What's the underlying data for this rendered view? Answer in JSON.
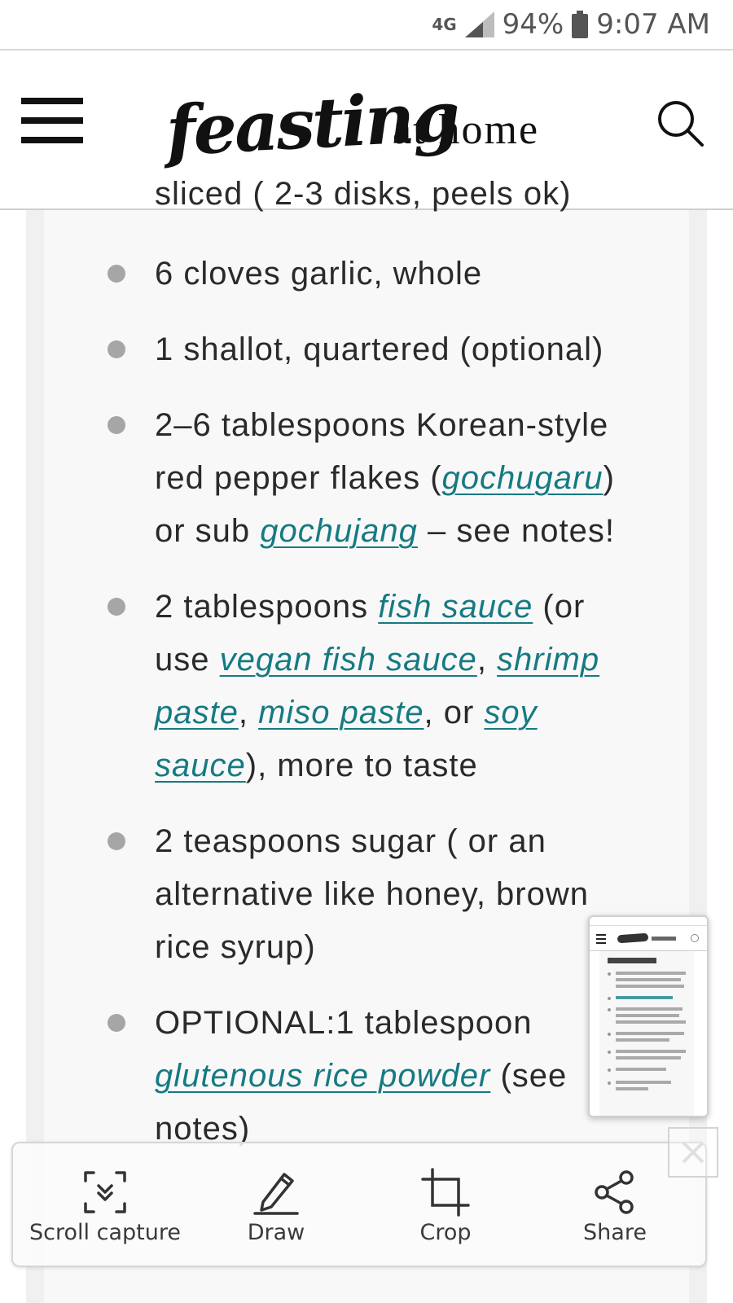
{
  "status_bar": {
    "network": "4G",
    "battery": "94%",
    "time": "9:07 AM"
  },
  "header": {
    "logo_script": "feasting",
    "logo_rest": "at home"
  },
  "partial_line": "sliced ( 2-3 disks, peels ok)",
  "ingredients": [
    {
      "parts": [
        {
          "text": "6 cloves garlic, whole"
        }
      ]
    },
    {
      "parts": [
        {
          "text": "1 shallot, quartered (optional)"
        }
      ]
    },
    {
      "parts": [
        {
          "text": "2–6 tablespoons Korean-style red pepper flakes ("
        },
        {
          "text": "gochugaru",
          "link": true
        },
        {
          "text": ") or sub "
        },
        {
          "text": "gochujang",
          "link": true
        },
        {
          "text": " – see notes!"
        }
      ]
    },
    {
      "parts": [
        {
          "text": "2 tablespoons "
        },
        {
          "text": "fish sauce",
          "link": true
        },
        {
          "text": " (or use "
        },
        {
          "text": "vegan fish sauce",
          "link": true
        },
        {
          "text": ", "
        },
        {
          "text": "shrimp paste",
          "link": true
        },
        {
          "text": ", "
        },
        {
          "text": "miso paste",
          "link": true
        },
        {
          "text": ", or "
        },
        {
          "text": "soy sauce",
          "link": true
        },
        {
          "text": "), more to taste"
        }
      ]
    },
    {
      "parts": [
        {
          "text": "2 teaspoons sugar ( or an alternative like honey, brown rice syrup)"
        }
      ]
    },
    {
      "parts": [
        {
          "text": " OPTIONAL:1 tablespoon "
        },
        {
          "text": "glutenous rice powder",
          "link": true
        },
        {
          "text": " (see notes)"
        }
      ]
    }
  ],
  "toolbar": {
    "scroll_capture": "Scroll capture",
    "draw": "Draw",
    "crop": "Crop",
    "share": "Share"
  },
  "colors": {
    "link": "#167a82",
    "bullet": "#a6a6a6",
    "text": "#2a2a2a"
  },
  "icons": {
    "menu": "hamburger-menu-icon",
    "search": "search-icon",
    "scroll_capture": "scroll-capture-icon",
    "draw": "pencil-icon",
    "crop": "crop-icon",
    "share": "share-icon",
    "close": "close-icon"
  }
}
